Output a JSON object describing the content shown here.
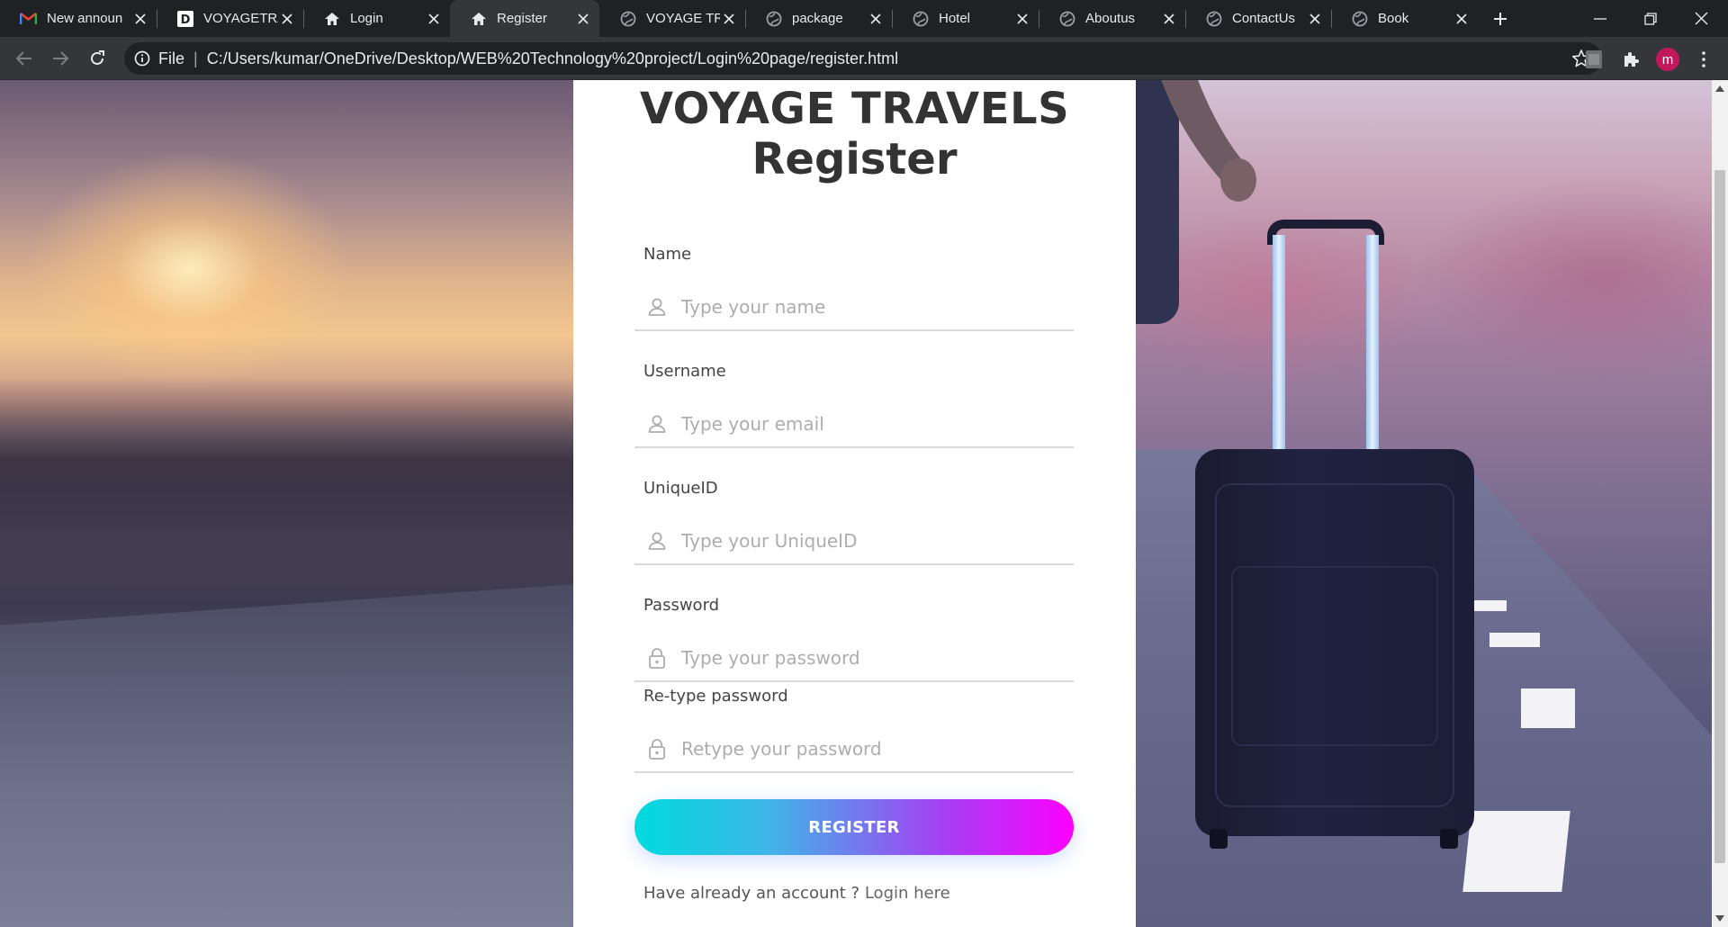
{
  "browser": {
    "tabs": [
      {
        "title": "New announ",
        "favicon": "gmail-icon",
        "active": false
      },
      {
        "title": "VOYAGETRA",
        "favicon": "voyage-d-icon",
        "active": false
      },
      {
        "title": "Login",
        "favicon": "home-icon",
        "active": false
      },
      {
        "title": "Register",
        "favicon": "home-icon",
        "active": true
      },
      {
        "title": "VOYAGE TR",
        "favicon": "globe-icon",
        "active": false
      },
      {
        "title": "package",
        "favicon": "globe-icon",
        "active": false
      },
      {
        "title": "Hotel",
        "favicon": "globe-icon",
        "active": false
      },
      {
        "title": "Aboutus",
        "favicon": "globe-icon",
        "active": false
      },
      {
        "title": "ContactUs",
        "favicon": "globe-icon",
        "active": false
      },
      {
        "title": "Book",
        "favicon": "globe-icon",
        "active": false
      }
    ],
    "address": {
      "scheme_label": "File",
      "separator": "|",
      "url": "C:/Users/kumar/OneDrive/Desktop/WEB%20Technology%20project/Login%20page/register.html"
    },
    "profile_initial": "m",
    "profile_color": "#c2185b"
  },
  "page": {
    "brand": "VOYAGE TRAVELS",
    "title": "Register",
    "fields": {
      "name": {
        "label": "Name",
        "placeholder": "Type your name",
        "icon": "user-icon"
      },
      "username": {
        "label": "Username",
        "placeholder": "Type your email",
        "icon": "user-icon"
      },
      "uniqueid": {
        "label": "UniqueID",
        "placeholder": "Type your UniqueID",
        "icon": "user-icon"
      },
      "password": {
        "label": "Password",
        "placeholder": "Type your password",
        "icon": "lock-icon"
      },
      "retype": {
        "label": "Re-type password",
        "placeholder": "Retype your password",
        "icon": "lock-icon"
      }
    },
    "register_button": "REGISTER",
    "footer_prompt": "Have already an account ?",
    "login_link": "Login here",
    "colors": {
      "button_gradient_start": "#00dbde",
      "button_gradient_end": "#fc00ff",
      "heading": "#333333",
      "placeholder": "#adadad"
    }
  }
}
